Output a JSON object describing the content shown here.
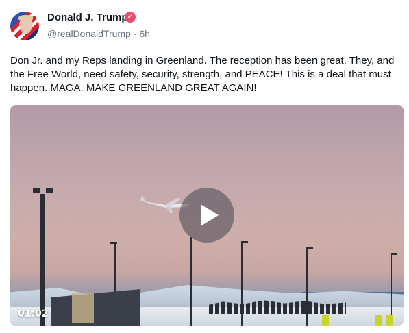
{
  "post": {
    "author_name": "Donald J. Trump",
    "handle": "@realDonaldTrump",
    "separator": " · ",
    "time": "6h",
    "text": "Don Jr. and my Reps landing in Greenland. The reception has been great. They, and the Free World, need safety, security, strength, and PEACE! This is a deal that must happen. MAGA. MAKE GREENLAND GREAT AGAIN!",
    "verified_icon": "✓"
  },
  "video": {
    "duration": "01:02",
    "play_icon": "play-icon"
  },
  "colors": {
    "verified_badge": "#ea4b6f",
    "handle_text": "#6b7280"
  }
}
